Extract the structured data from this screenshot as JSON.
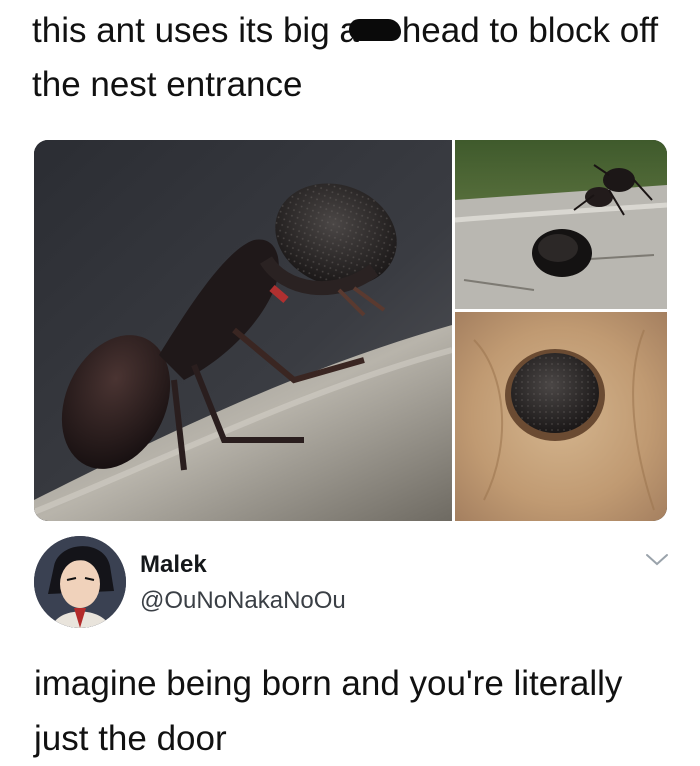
{
  "post": {
    "caption_part1": "this ant uses its big a",
    "caption_part2": "head to block off the nest entrance"
  },
  "tweet": {
    "display_name": "Malek",
    "handle": "@OuNoNakaNoOu",
    "text": "imagine being born and you're literally just the door"
  },
  "icons": {
    "avatar": "avatar-icon",
    "more": "chevron-down-icon"
  },
  "colors": {
    "text": "#111111",
    "handle": "#3a3f45",
    "chevron": "#9aa3ab"
  }
}
